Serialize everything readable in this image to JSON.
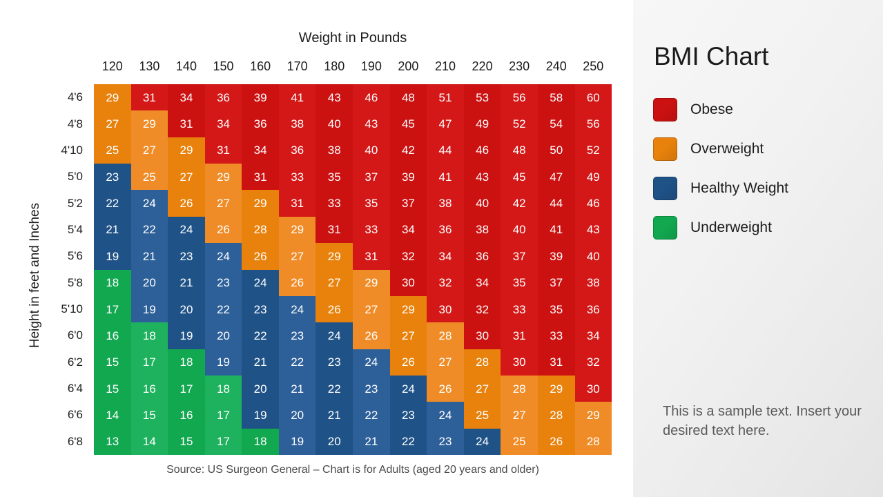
{
  "chart": {
    "x_axis_title": "Weight in Pounds",
    "y_axis_title": "Height in feet and Inches",
    "source_note": "Source: US Surgeon General – Chart is for Adults (aged 20 years and older)"
  },
  "sidebar": {
    "title": "BMI Chart",
    "sample_text": "This is a sample text. Insert your desired text here.",
    "legend": [
      {
        "label": "Obese",
        "color": "#cc1111"
      },
      {
        "label": "Overweight",
        "color": "#e8820c"
      },
      {
        "label": "Healthy Weight",
        "color": "#1f5287"
      },
      {
        "label": "Underweight",
        "color": "#12a850"
      }
    ]
  },
  "category_colors": {
    "obese": {
      "dark": "#cc1111",
      "light": "#d41818"
    },
    "overweight": {
      "dark": "#e8820c",
      "light": "#f08c28"
    },
    "healthy": {
      "dark": "#1f5287",
      "light": "#2d6099"
    },
    "underweight": {
      "dark": "#12a850",
      "light": "#1fb25e"
    }
  },
  "chart_data": {
    "type": "heatmap",
    "title": "BMI Chart",
    "xlabel": "Weight in Pounds",
    "ylabel": "Height in feet and Inches",
    "legend_position": "right",
    "grid": false,
    "categories": [
      "Underweight",
      "Healthy Weight",
      "Overweight",
      "Obese"
    ],
    "category_thresholds": {
      "underweight_max": 18,
      "healthy_max": 24,
      "overweight_max": 29,
      "obese_min": 30
    },
    "x": [
      120,
      130,
      140,
      150,
      160,
      170,
      180,
      190,
      200,
      210,
      220,
      230,
      240,
      250
    ],
    "y": [
      "4'6",
      "4'8",
      "4'10",
      "5'0",
      "5'2",
      "5'4",
      "5'6",
      "5'8",
      "5'10",
      "6'0",
      "6'2",
      "6'4",
      "6'6",
      "6'8"
    ],
    "values": [
      [
        29,
        31,
        34,
        36,
        39,
        41,
        43,
        46,
        48,
        51,
        53,
        56,
        58,
        60
      ],
      [
        27,
        29,
        31,
        34,
        36,
        38,
        40,
        43,
        45,
        47,
        49,
        52,
        54,
        56
      ],
      [
        25,
        27,
        29,
        31,
        34,
        36,
        38,
        40,
        42,
        44,
        46,
        48,
        50,
        52
      ],
      [
        23,
        25,
        27,
        29,
        31,
        33,
        35,
        37,
        39,
        41,
        43,
        45,
        47,
        49
      ],
      [
        22,
        24,
        26,
        27,
        29,
        31,
        33,
        35,
        37,
        38,
        40,
        42,
        44,
        46
      ],
      [
        21,
        22,
        24,
        26,
        28,
        29,
        31,
        33,
        34,
        36,
        38,
        40,
        41,
        43
      ],
      [
        19,
        21,
        23,
        24,
        26,
        27,
        29,
        31,
        32,
        34,
        36,
        37,
        39,
        40
      ],
      [
        18,
        20,
        21,
        23,
        24,
        26,
        27,
        29,
        30,
        32,
        34,
        35,
        37,
        38
      ],
      [
        17,
        19,
        20,
        22,
        23,
        24,
        26,
        27,
        29,
        30,
        32,
        33,
        35,
        36
      ],
      [
        16,
        18,
        19,
        20,
        22,
        23,
        24,
        26,
        27,
        28,
        30,
        31,
        33,
        34
      ],
      [
        15,
        17,
        18,
        19,
        21,
        22,
        23,
        24,
        26,
        27,
        28,
        30,
        31,
        32
      ],
      [
        15,
        16,
        17,
        18,
        20,
        21,
        22,
        23,
        24,
        26,
        27,
        28,
        29,
        30
      ],
      [
        14,
        15,
        16,
        17,
        19,
        20,
        21,
        22,
        23,
        24,
        25,
        27,
        28,
        29
      ],
      [
        13,
        14,
        15,
        17,
        18,
        19,
        20,
        21,
        22,
        23,
        24,
        25,
        26,
        28
      ]
    ]
  }
}
